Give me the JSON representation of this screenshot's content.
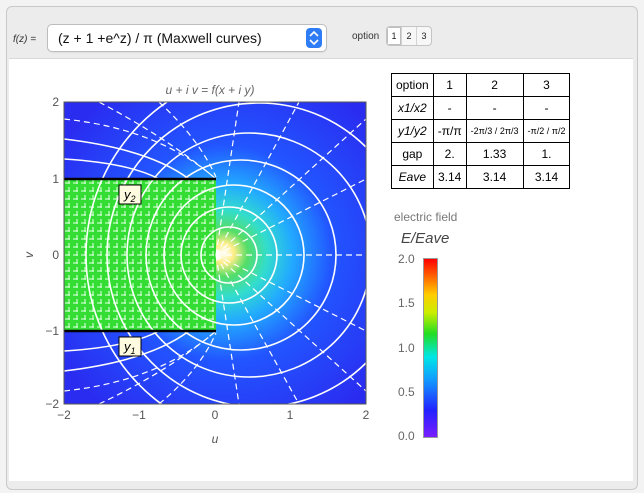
{
  "controls": {
    "fz_label": "f(z) =",
    "selected": "(z + 1 +e^z) / π (Maxwell curves)",
    "option_label": "option",
    "options": [
      "1",
      "2",
      "3"
    ],
    "selected_option": "1"
  },
  "plot": {
    "title": "u + i v = f(x + i y)",
    "xlabel": "u",
    "ylabel": "v",
    "x_ticks": [
      "−2",
      "−1",
      "0",
      "1",
      "2"
    ],
    "y_ticks": [
      "2",
      "1",
      "0",
      "−1",
      "−2"
    ],
    "y2_label": "y2",
    "y1_label": "y1"
  },
  "table": {
    "headers": [
      "option",
      "1",
      "2",
      "3"
    ],
    "rows": [
      {
        "label": "x1/x2",
        "values": [
          "-",
          "-",
          "-"
        ]
      },
      {
        "label": "y1/y2",
        "values": [
          "-π/π",
          "-2π/3 / 2π/3",
          "-π/2 / π/2"
        ]
      },
      {
        "label": "gap",
        "values": [
          "2.",
          "1.33",
          "1."
        ]
      },
      {
        "label": "Eave",
        "values": [
          "3.14",
          "3.14",
          "3.14"
        ]
      }
    ]
  },
  "colorbar": {
    "title": "electric field",
    "subtitle": "E/Eave",
    "ticks": [
      "2.0",
      "1.5",
      "1.0",
      "0.5",
      "0.0"
    ],
    "colors": {
      "low": "#7a1dff",
      "mid": "#22dd22",
      "high": "#ff0000"
    }
  }
}
